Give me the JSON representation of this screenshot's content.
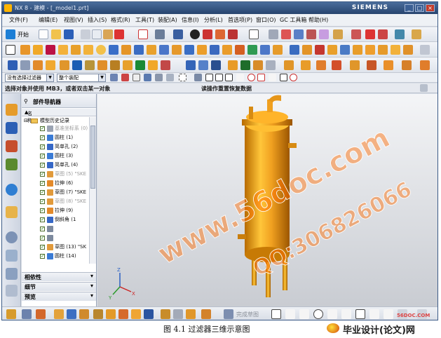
{
  "window": {
    "title": "NX 8 - 建模 - [_model1.prt]",
    "brand": "SIEMENS",
    "controls": [
      "_",
      "□",
      "×"
    ]
  },
  "menu": [
    "文件(F)",
    "编辑(E)",
    "视图(V)",
    "插入(S)",
    "格式(R)",
    "工具(T)",
    "装配(A)",
    "信息(I)",
    "分析(L)",
    "首选项(P)",
    "窗口(O)",
    "GC 工具箱",
    "帮助(H)"
  ],
  "toolbar": {
    "start_label": "开始"
  },
  "selection_bar": {
    "filter_value": "没有选择过滤器",
    "scope_value": "整个装配"
  },
  "cue": {
    "prompt": "选择对象并使用 MB3，或者双击某一对象",
    "status": "读操作重置恢复数据"
  },
  "navigator": {
    "title": "部件导航器",
    "column_header": "名称",
    "root": "模型历史记录",
    "items": [
      {
        "label": "基准坐标系 (0)",
        "dim": true
      },
      {
        "label": "圆柱 (1)",
        "dim": false
      },
      {
        "label": "简单孔 (2)",
        "dim": false
      },
      {
        "label": "圆柱 (3)",
        "dim": false
      },
      {
        "label": "简单孔 (4)",
        "dim": false
      },
      {
        "label": "草图 (5) \"SKE",
        "dim": true
      },
      {
        "label": "拉伸 (6)",
        "dim": false
      },
      {
        "label": "草图 (7) \"SKE",
        "dim": false
      },
      {
        "label": "草图 (8) \"SKE",
        "dim": true
      },
      {
        "label": "拉伸 (9)",
        "dim": false
      },
      {
        "label": "倒斜角 (1",
        "dim": false
      },
      {
        "label": "",
        "dim": false
      },
      {
        "label": "",
        "dim": false
      },
      {
        "label": "草图 (13) \"SK",
        "dim": false
      },
      {
        "label": "圆柱 (14)",
        "dim": false
      }
    ],
    "sections": [
      "相依性",
      "细节",
      "预览"
    ]
  },
  "viewport": {
    "watermark1": "www.56doc.com",
    "watermark2": "QQ:306826066",
    "model_color": "#f0a020"
  },
  "bottombar": {
    "finish_sketch": "完成草图"
  },
  "caption": "图 4.1  过滤器三维示意图",
  "site_logo": "毕业设计(论文)网",
  "site_url": "56DOC.COM"
}
